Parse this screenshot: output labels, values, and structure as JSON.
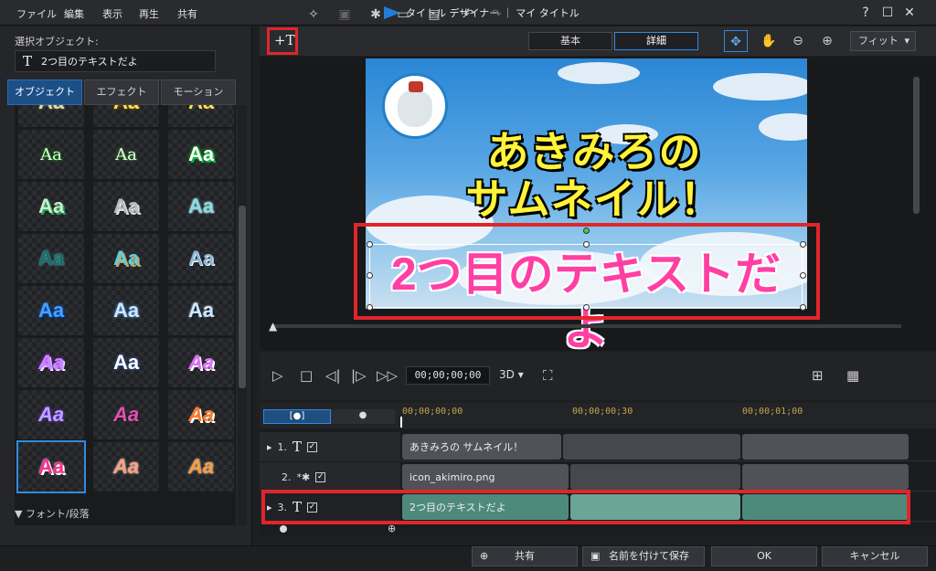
{
  "menu": [
    "ファイル",
    "編集",
    "表示",
    "再生",
    "共有"
  ],
  "window": {
    "title": "タイトル デザイナー ｜ マイ タイトル",
    "help": "?",
    "maximize": "☐",
    "close": "✕"
  },
  "left_panel": {
    "selected_label": "選択オブジェクト:",
    "selected_object": "2つ目のテキストだよ",
    "tabs": [
      "オブジェクト",
      "エフェクト",
      "モーション"
    ],
    "active_tab": "オブジェクト",
    "section_label": "フォント/段落",
    "presets": [
      "Aa",
      "Aa",
      "Aa",
      "Aa",
      "Aa",
      "Aa",
      "Aa",
      "Aa",
      "Aa",
      "Aa",
      "Aa",
      "Aa",
      "Aa",
      "Aa",
      "Aa",
      "Aa",
      "Aa",
      "Aa",
      "Aa",
      "Aa",
      "Aa",
      "Aa",
      "Aa",
      "Aa"
    ]
  },
  "toolbar": {
    "mode_basic": "基本",
    "mode_detail": "詳細",
    "fit_label": "フィット"
  },
  "preview": {
    "headline_line1": "あきみろの",
    "headline_line2": "サムネイル！",
    "pink_text": "2つ目のテキストだよ"
  },
  "playback": {
    "timecode": "00;00;00;00",
    "mode3d": "3D ▾"
  },
  "timeline": {
    "ruler": [
      "00;00;00;00",
      "00;00;00;30",
      "00;00;01;00"
    ],
    "tracks": [
      {
        "index": "1.",
        "clip": "あきみろの サムネイル！"
      },
      {
        "index": "2.",
        "clip": "icon_akimiro.png"
      },
      {
        "index": "3.",
        "clip": "2つ目のテキストだよ"
      }
    ]
  },
  "buttons": {
    "share": "共有",
    "save_as": "名前を付けて保存",
    "ok": "OK",
    "cancel": "キャンセル"
  },
  "colors": {
    "accent": "#2f8be0",
    "highlight_red": "#e0262b",
    "headline": "#fff33a",
    "pink": "#ff3fa3"
  }
}
